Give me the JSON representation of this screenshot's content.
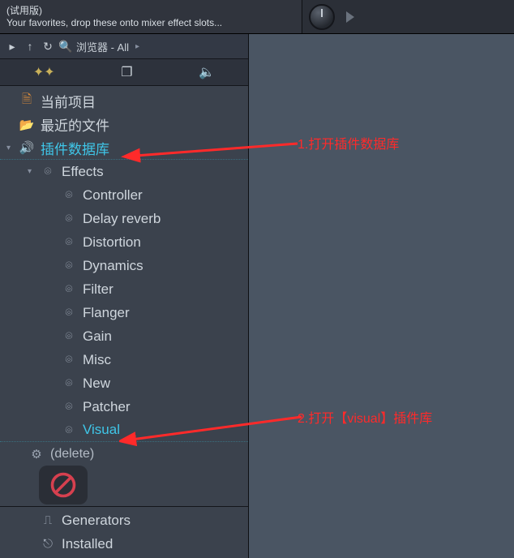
{
  "hint": {
    "title": "(试用版)",
    "text": "Your favorites, drop these onto mixer effect slots..."
  },
  "browser": {
    "header_label": "浏览器 - All"
  },
  "tree": {
    "current_project": "当前项目",
    "recent_files": "最近的文件",
    "plugin_db": "插件数据库",
    "effects": "Effects",
    "effects_children": [
      "Controller",
      "Delay reverb",
      "Distortion",
      "Dynamics",
      "Filter",
      "Flanger",
      "Gain",
      "Misc",
      "New",
      "Patcher",
      "Visual"
    ],
    "delete_label": "(delete)",
    "generators": "Generators",
    "installed": "Installed"
  },
  "annotations": {
    "a1": "1.打开插件数据库",
    "a2": "2.打开【visual】插件库"
  }
}
